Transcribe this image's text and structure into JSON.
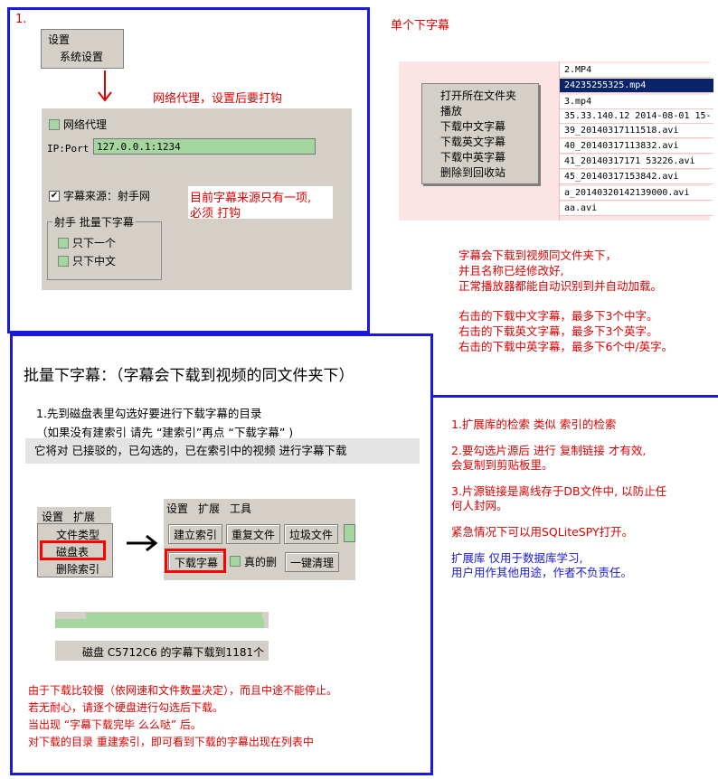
{
  "panel1": {
    "number": "1.",
    "menu_settings": "设置",
    "menu_system_settings": "系统设置",
    "proxy_note": "网络代理，设置后要打钩",
    "proxy_checkbox": "网络代理",
    "ip_label": "IP:Port",
    "ip_value": "127.0.0.1:1234",
    "source_label": "字幕来源：射手网",
    "source_note_1": "目前字幕来源只有一项,",
    "source_note_2": "必须  打钩",
    "group_title": "射手  批量下字幕",
    "opt_first": "只下一个",
    "opt_chinese": "只下中文"
  },
  "single": {
    "title": "单个下字幕",
    "files": [
      "2.MP4",
      "24235255325.mp4",
      "3.mp4",
      "35.33.140.12 2014-08-01 15-",
      "39_20140317111518.avi",
      "40_20140317113832.avi",
      "41_20140317171 53226.avi",
      "45_20140317153842.avi",
      "a_20140320142139000.avi",
      "aa.avi"
    ],
    "context_menu": [
      "打开所在文件夹",
      "播放",
      "下载中文字幕",
      "下载英文字幕",
      "下载中英字幕",
      "删除到回收站"
    ],
    "note_1": "字幕会下载到视频同文件夹下，",
    "note_2": "并且名称已经修改好,",
    "note_3": "正常播放器都能自动识别到并自动加载。",
    "note_4": "右击的下载中文字幕，最多下3个中字。",
    "note_5": "右击的下载英文字幕，最多下3个英字。",
    "note_6": "右击的下载中英字幕，最多下6个中/英字。"
  },
  "batch": {
    "title": "批量下字幕：（字幕会下载到视频的同文件夹下）",
    "step_1": "1.先到磁盘表里勾选好要进行下载字幕的目录",
    "step_2": "（如果没有建索引 请先 “建索引”再点 “下载字幕” )",
    "step_3": "它将对 已接驳的，已勾选的，已在索引中的视频 进行字幕下载",
    "menu_settings": "设置",
    "menu_extend": "扩展",
    "menu_item_filetype": "文件类型",
    "menu_item_disktable": "磁盘表",
    "menu_item_delindex": "删除索引",
    "tb_settings": "设置",
    "tb_extend": "扩展",
    "tb_tools": "工具",
    "btn_build_index": "建立索引",
    "btn_dup_files": "重复文件",
    "btn_trash_files": "垃圾文件",
    "btn_download_subs": "下载字幕",
    "chk_real_delete": "真的删",
    "btn_one_click_clean": "一键清理",
    "progress_value": 0.98,
    "status_text": "磁盘 C5712C6 的字幕下载到1181个",
    "note_1": "由于下载比较慢（依网速和文件数量决定），而且中途不能停止。",
    "note_2": "若无耐心，请逐个硬盘进行勾选后下载。",
    "note_3": "当出现 “字幕下载完毕 么么哒” 后。",
    "note_4": "对下载的目录 重建索引，即可看到下载的字幕出现在列表中"
  },
  "right_notes": {
    "n1": "1.扩展库的检索 类似 索引的检索",
    "n2a": "2.要勾选片源后 进行 复制链接 才有效,",
    "n2b": "会复制到剪贴板里。",
    "n3a": "3.片源链接是离线存于DB文件中, 以防止任",
    "n3b": "何人封网。",
    "n4": "紧急情况下可以用SQLiteSPY打开。",
    "n5a": "扩展库 仅用于数据库学习,",
    "n5b": "用户用作其他用途，作者不负责任。"
  },
  "colors": {
    "accent_blue": "#1a1adc",
    "red": "#e00000",
    "selection": "#0a246a",
    "ui_gray": "#d4d0c8",
    "green": "#a6d6a0"
  }
}
